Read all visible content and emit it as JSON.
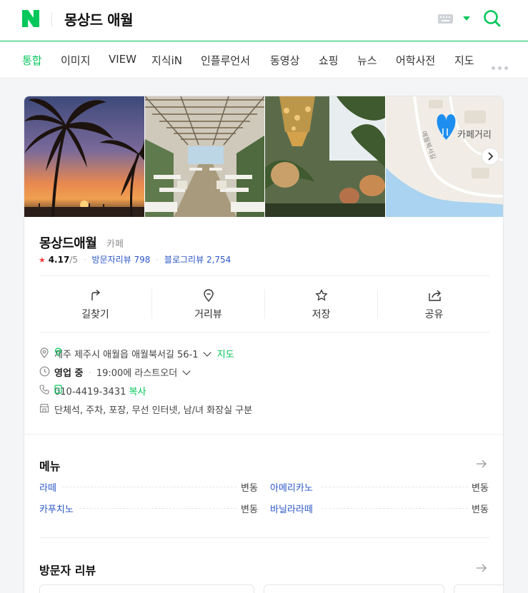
{
  "header": {
    "query": "몽상드 애월",
    "colors": {
      "brand": "#03c75a",
      "link": "#2a56c6",
      "star": "#f43f3f"
    }
  },
  "tabs": [
    {
      "label": "통합",
      "active": true
    },
    {
      "label": "이미지"
    },
    {
      "label": "VIEW"
    },
    {
      "label": "지식iN"
    },
    {
      "label": "인플루언서"
    },
    {
      "label": "동영상"
    },
    {
      "label": "쇼핑"
    },
    {
      "label": "뉴스"
    },
    {
      "label": "어학사전"
    },
    {
      "label": "지도"
    }
  ],
  "place": {
    "name": "몽상드애월",
    "category": "카페",
    "rating": "4.17",
    "rating_max": "/5",
    "visitor_reviews_label": "방문자리뷰",
    "visitor_reviews_count": "798",
    "blog_reviews_label": "블로그리뷰",
    "blog_reviews_count": "2,754",
    "map_thumb_label": "카페거리"
  },
  "actions": [
    {
      "label": "길찾기",
      "icon": "directions-icon"
    },
    {
      "label": "거리뷰",
      "icon": "streetview-icon"
    },
    {
      "label": "저장",
      "icon": "star-icon"
    },
    {
      "label": "공유",
      "icon": "share-icon"
    }
  ],
  "info": {
    "address": "제주 제주시 애월읍 애월북서길 56-1",
    "map_link": "지도",
    "status": "영업 중",
    "last_order": "19:00에 라스트오더",
    "phone": "010-4419-3431",
    "copy_label": "복사",
    "facilities": "단체석, 주차, 포장, 무선 인터넷, 남/녀 화장실 구분"
  },
  "menu": {
    "title": "메뉴",
    "items": [
      {
        "name": "라떼",
        "price": "변동"
      },
      {
        "name": "아메리카노",
        "price": "변동"
      },
      {
        "name": "카푸치노",
        "price": "변동"
      },
      {
        "name": "바닐라라떼",
        "price": "변동"
      }
    ]
  },
  "reviews": {
    "title": "방문자 리뷰"
  }
}
